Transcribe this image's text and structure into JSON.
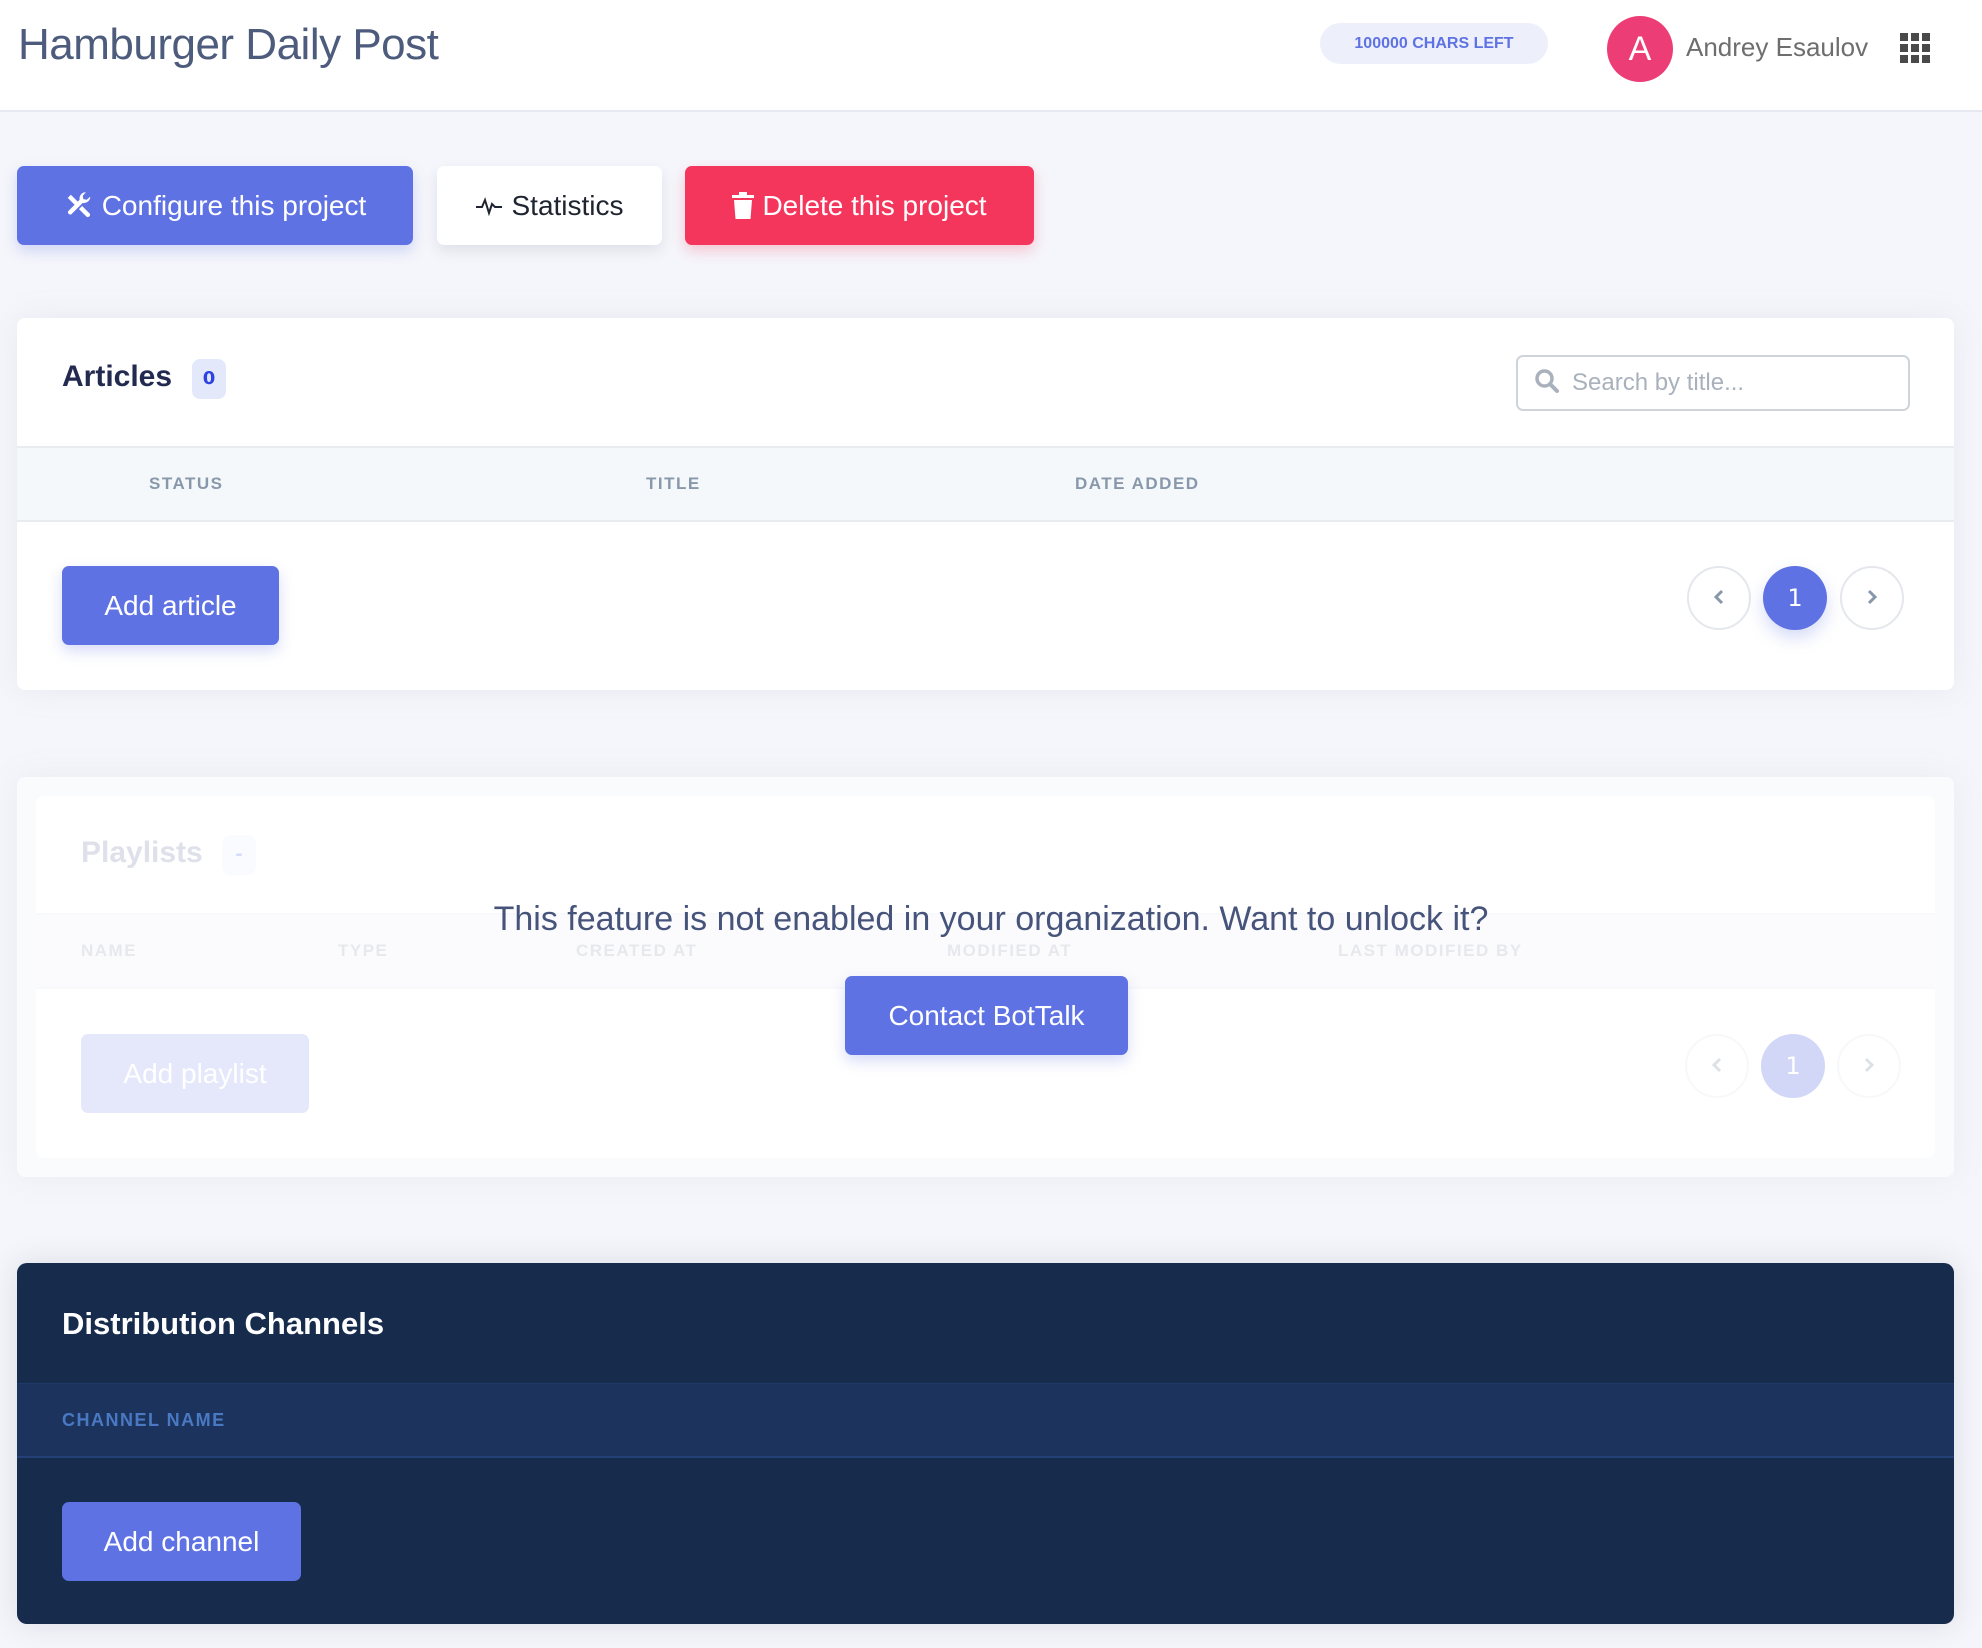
{
  "header": {
    "title": "Hamburger Daily Post",
    "chars_left": "100000 CHARS LEFT",
    "user": {
      "initial": "A",
      "name": "Andrey Esaulov",
      "avatar_color": "#ec3d77"
    },
    "apps_icon": "grid-icon"
  },
  "actions": {
    "configure": {
      "label": "Configure this project",
      "icon": "tools-icon"
    },
    "statistics": {
      "label": "Statistics",
      "icon": "pulse-icon"
    },
    "delete": {
      "label": "Delete this project",
      "icon": "trash-icon"
    }
  },
  "articles": {
    "title": "Articles",
    "count": "0",
    "search_placeholder": "Search by title...",
    "columns": [
      "STATUS",
      "TITLE",
      "DATE ADDED"
    ],
    "rows": [],
    "add_label": "Add article",
    "pagination": {
      "prev": "‹",
      "current": "1",
      "next": "›"
    }
  },
  "playlists": {
    "title": "Playlists",
    "count": "-",
    "columns": [
      "NAME",
      "TYPE",
      "CREATED AT",
      "MODIFIED AT",
      "LAST MODIFIED BY"
    ],
    "add_label": "Add playlist",
    "pagination": {
      "prev": "‹",
      "current": "1",
      "next": "›"
    },
    "locked_message": "This feature is not enabled in your organization. Want to unlock it?",
    "contact_label": "Contact BotTalk"
  },
  "distribution": {
    "title": "Distribution Channels",
    "columns": [
      "CHANNEL NAME"
    ],
    "add_label": "Add channel"
  },
  "colors": {
    "primary": "#5f72e3",
    "danger": "#f5365c",
    "dark": "#172b4d",
    "background": "#f5f6fb"
  }
}
